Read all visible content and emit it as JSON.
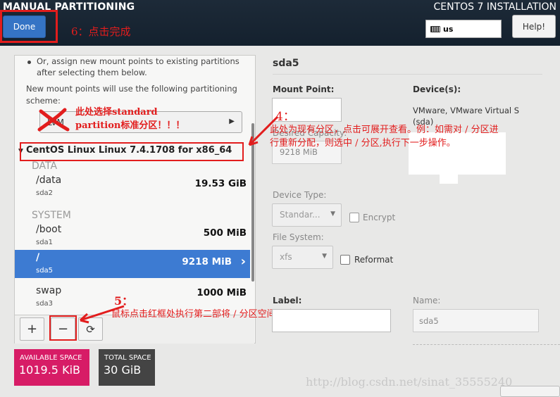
{
  "header": {
    "title": "MANUAL PARTITIONING",
    "install_title": "CENTOS 7 INSTALLATION",
    "done_label": "Done",
    "keyboard_layout": "us",
    "help_label": "Help!"
  },
  "annotations": {
    "step6": "6：点击完成",
    "step_x_line1": "此处选择standard",
    "step_x_line2": "partition标准分区！！！",
    "step4_num": "4：",
    "step4_line1": "此处为现有分区，点击可展开查看。例：如需对 / 分区进",
    "step4_line2": "行重新分配，则选中 / 分区,执行下一步操作。",
    "step5_num": "5：",
    "step5_text": "鼠标点击红框处执行第二部将 / 分区空间回收。",
    "watermark": "http://blog.csdn.net/sinat_35555240"
  },
  "left": {
    "assign_text_1": "Or, assign new mount points to existing partitions",
    "assign_text_2": "after selecting them below.",
    "scheme_text_1": "New mount points will use the following partitioning",
    "scheme_text_2": "scheme:",
    "scheme_value": "LVM",
    "system_label": "CentOS Linux Linux 7.4.1708 for x86_64",
    "groups": [
      {
        "name": "DATA",
        "items": [
          {
            "mount": "/data",
            "device": "sda2",
            "size": "19.53 GiB"
          }
        ]
      },
      {
        "name": "SYSTEM",
        "items": [
          {
            "mount": "/boot",
            "device": "sda1",
            "size": "500 MiB"
          },
          {
            "mount": "/",
            "device": "sda5",
            "size": "9218 MiB",
            "selected": true
          },
          {
            "mount": "swap",
            "device": "sda3",
            "size": "1000 MiB"
          }
        ]
      }
    ],
    "add_label": "+",
    "remove_label": "−",
    "refresh_label": "⟳"
  },
  "space": {
    "available_label": "AVAILABLE SPACE",
    "available_value": "1019.5 KiB",
    "total_label": "TOTAL SPACE",
    "total_value": "30 GiB"
  },
  "details": {
    "partition_title": "sda5",
    "mount_point_label": "Mount Point:",
    "mount_point_value": "",
    "desired_capacity_label": "Desired Capacity:",
    "desired_capacity_value": "9218 MiB",
    "devices_label": "Device(s):",
    "device_line1": "VMware, VMware Virtual S",
    "device_line2": "(sda)",
    "device_type_label": "Device Type:",
    "device_type_value": "Standar...",
    "encrypt_label": "Encrypt",
    "fs_label": "File System:",
    "fs_value": "xfs",
    "reformat_label": "Reformat",
    "label_label": "Label:",
    "label_value": "",
    "name_label": "Name:",
    "name_value": "sda5"
  },
  "colors": {
    "accent": "#3d7bd2",
    "available": "#d71c66",
    "total": "#444444",
    "annotation": "#e21d1d",
    "header": "#1a2734"
  }
}
